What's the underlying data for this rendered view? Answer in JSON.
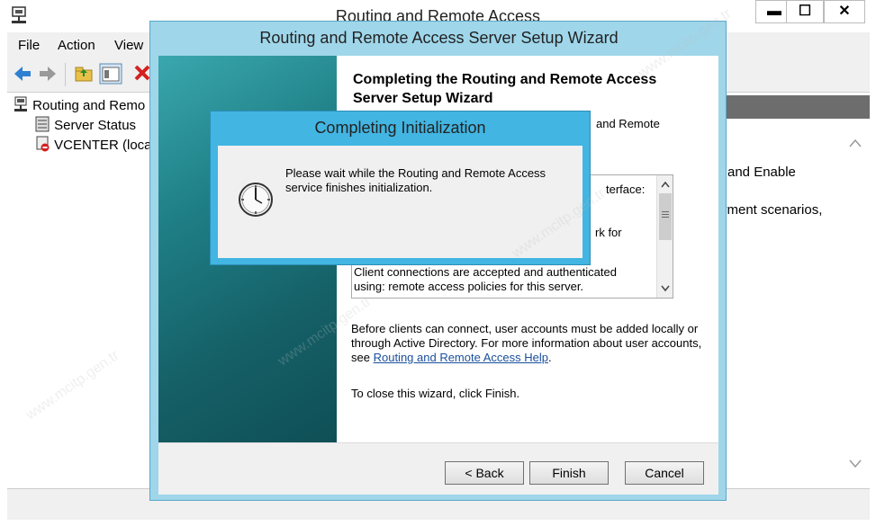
{
  "main_window": {
    "title": "Routing and Remote Access",
    "controls": {
      "minimize": "▬",
      "maximize": "☐",
      "close": "✕"
    },
    "menu": [
      "File",
      "Action",
      "View"
    ],
    "toolbar_icons": [
      "back-arrow-icon",
      "forward-arrow-icon",
      "up-folder-icon",
      "show-hide-tree-icon",
      "delete-icon"
    ],
    "tree": [
      {
        "label": "Routing and Remo",
        "icon": "server-icon"
      },
      {
        "label": "Server Status",
        "icon": "server-status-icon"
      },
      {
        "label": "VCENTER (loca",
        "icon": "server-stopped-icon"
      }
    ],
    "right_pane_fragments": [
      "and Enable",
      "yment scenarios,"
    ]
  },
  "wizard": {
    "title": "Routing and Remote Access Server Setup Wizard",
    "heading": "Completing the Routing and Remote Access Server Setup Wizard",
    "fragment": "and Remote",
    "summary_fragments": [
      "terface:",
      "rk for"
    ],
    "summary_text": "Client connections are accepted and authenticated using: remote access policies for this server.",
    "users_text": "Before clients can connect, user accounts must be added locally or through Active Directory. For more information about user accounts, see",
    "help_link": "Routing and Remote Access Help",
    "help_link_suffix": ".",
    "close_text": "To close this wizard, click Finish.",
    "buttons": {
      "back": "< Back",
      "finish": "Finish",
      "cancel": "Cancel"
    }
  },
  "dialog": {
    "title": "Completing Initialization",
    "message": "Please wait while the Routing and Remote Access service finishes initialization.",
    "icon": "clock-icon"
  },
  "watermark": "www.mcitp.gen.tr",
  "colors": {
    "wizard_frame": "#9fd6ea",
    "dialog_frame": "#42b5e2",
    "banner": "#1f7f86",
    "link": "#1a4f9c"
  }
}
